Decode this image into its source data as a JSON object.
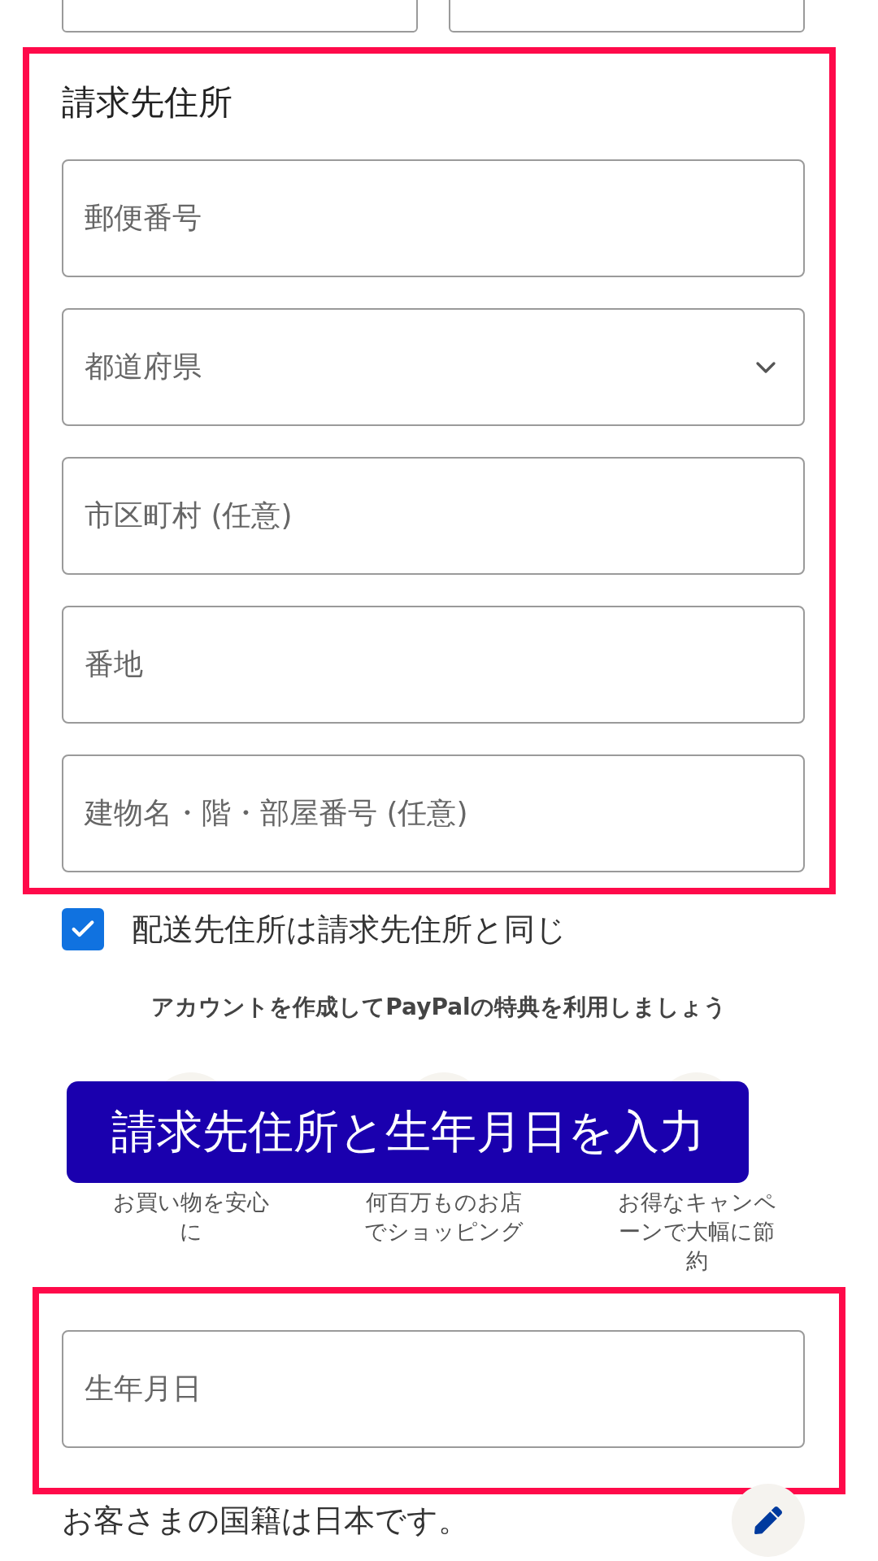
{
  "top_row": [
    {
      "kind": "text"
    },
    {
      "kind": "text"
    }
  ],
  "billing": {
    "heading": "請求先住所",
    "fields": [
      {
        "kind": "text",
        "placeholder": "郵便番号"
      },
      {
        "kind": "select",
        "placeholder": "都道府県"
      },
      {
        "kind": "text",
        "placeholder": "市区町村 (任意)"
      },
      {
        "kind": "text",
        "placeholder": "番地"
      },
      {
        "kind": "text",
        "placeholder": "建物名・階・部屋番号 (任意)"
      }
    ]
  },
  "same_address": {
    "label": "配送先住所は請求先住所と同じ",
    "checked": true
  },
  "promo": {
    "heading": "アカウントを作成してPayPalの特典を利用しましょう",
    "benefits": [
      {
        "text": "お買い物を安心に"
      },
      {
        "text": "何百万ものお店でショッピング"
      },
      {
        "text": "お得なキャンペーンで大幅に節約"
      }
    ]
  },
  "banner": {
    "text": "請求先住所と生年月日を入力"
  },
  "birth": {
    "placeholder": "生年月日"
  },
  "nationality": {
    "text": "お客さまの国籍は日本です。"
  }
}
